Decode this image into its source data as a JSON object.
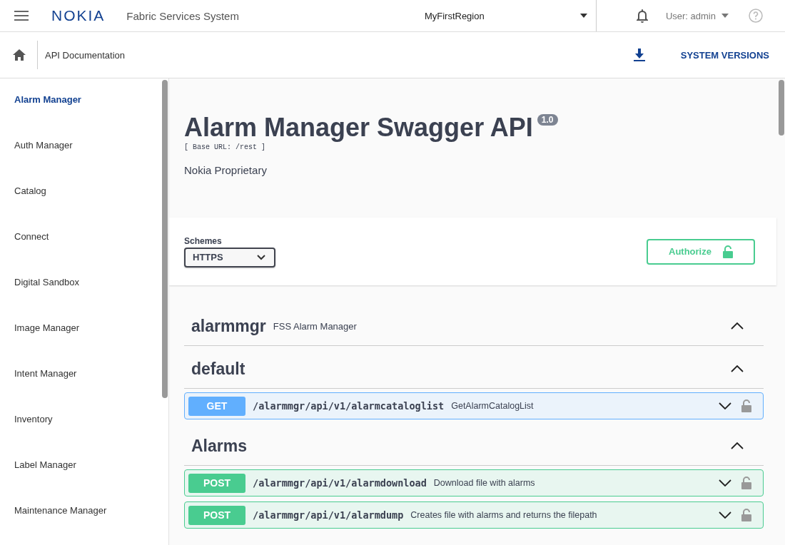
{
  "header": {
    "logo": "NOKIA",
    "app_title": "Fabric Services System",
    "region": "MyFirstRegion",
    "user": "User: admin"
  },
  "subheader": {
    "breadcrumb": "API Documentation",
    "system_versions": "SYSTEM VERSIONS"
  },
  "sidebar": {
    "items": [
      {
        "label": "Alarm Manager",
        "selected": true
      },
      {
        "label": "Auth Manager",
        "selected": false
      },
      {
        "label": "Catalog",
        "selected": false
      },
      {
        "label": "Connect",
        "selected": false
      },
      {
        "label": "Digital Sandbox",
        "selected": false
      },
      {
        "label": "Image Manager",
        "selected": false
      },
      {
        "label": "Intent Manager",
        "selected": false
      },
      {
        "label": "Inventory",
        "selected": false
      },
      {
        "label": "Label Manager",
        "selected": false
      },
      {
        "label": "Maintenance Manager",
        "selected": false
      }
    ]
  },
  "info": {
    "title": "Alarm Manager Swagger API",
    "version": "1.0",
    "base_url": "[ Base URL: /rest ]",
    "description": "Nokia Proprietary"
  },
  "schemes": {
    "label": "Schemes",
    "value": "HTTPS",
    "authorize": "Authorize"
  },
  "sections": [
    {
      "name": "alarmmgr",
      "description": "FSS Alarm Manager",
      "expanded": true
    },
    {
      "name": "default",
      "expanded": true,
      "operations": [
        {
          "method": "GET",
          "kind": "get",
          "path": "/alarmmgr/api/v1/alarmcataloglist",
          "summary": "GetAlarmCatalogList"
        }
      ]
    },
    {
      "name": "Alarms",
      "expanded": true,
      "operations": [
        {
          "method": "POST",
          "kind": "post",
          "path": "/alarmmgr/api/v1/alarmdownload",
          "summary": "Download file with alarms"
        },
        {
          "method": "POST",
          "kind": "post",
          "path": "/alarmmgr/api/v1/alarmdump",
          "summary": "Creates file with alarms and returns the filepath"
        }
      ]
    }
  ]
}
